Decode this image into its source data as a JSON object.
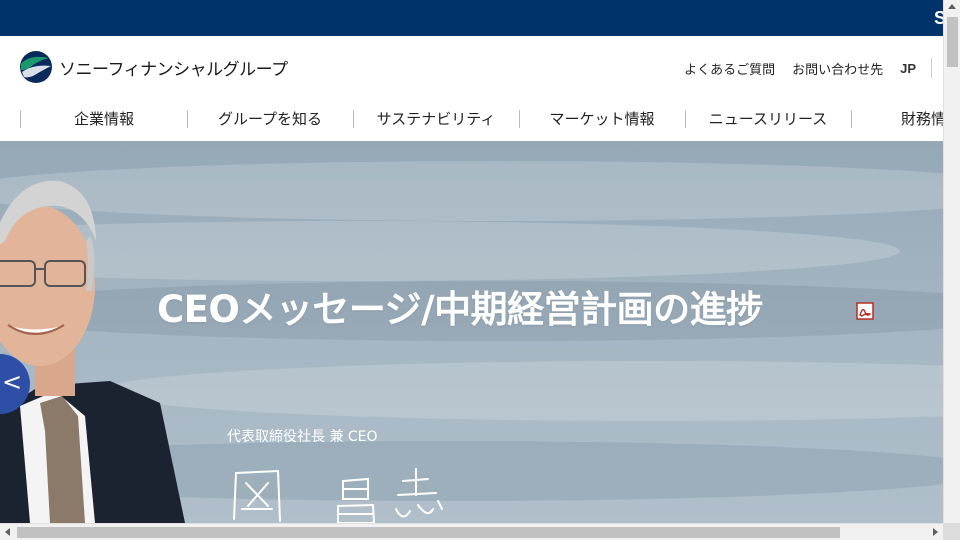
{
  "topbar": {
    "brand_mark": "S"
  },
  "header": {
    "logo_text": "ソニーフィナンシャルグループ",
    "util_links": [
      "よくあるご質問",
      "お問い合わせ先"
    ],
    "lang": "JP"
  },
  "nav": {
    "items": [
      "企業情報",
      "グループを知る",
      "サステナビリティ",
      "マーケット情報",
      "ニュースリリース",
      "財務情"
    ]
  },
  "hero": {
    "title": "CEOメッセージ/中期経営計画の進捗",
    "role": "代表取締役社長 兼 CEO",
    "prev_glyph": "<"
  },
  "colors": {
    "topbar": "#00336a",
    "accent_blue": "#2d4fa6",
    "logo_green": "#1a9a6c",
    "logo_navy": "#0b2a5c"
  }
}
